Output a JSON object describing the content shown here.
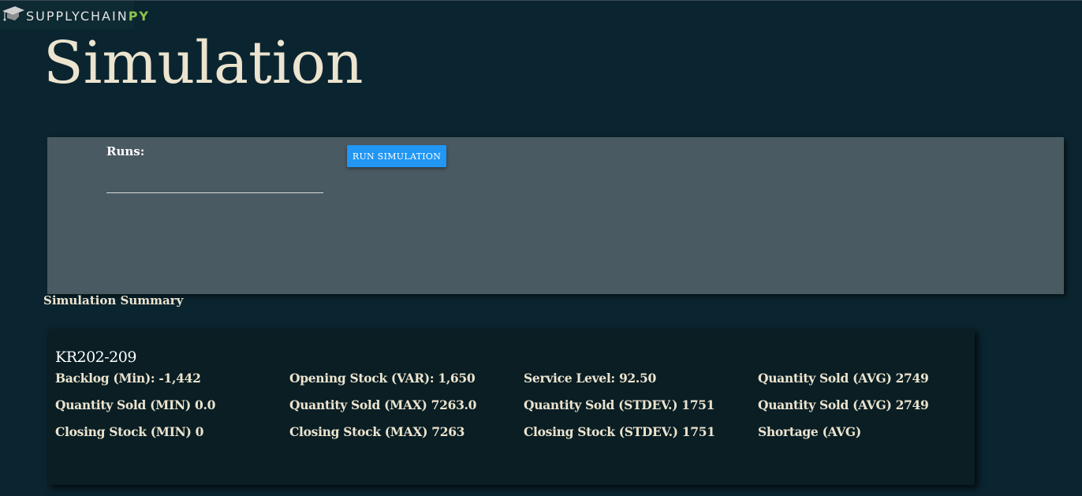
{
  "logo": {
    "text_main": "SUPPLYCHAIN",
    "text_accent": "PY",
    "icon": "graduation-cap-icon"
  },
  "page": {
    "title": "Simulation"
  },
  "controls": {
    "runs_label": "Runs:",
    "runs_value": "",
    "run_button_label": "RUN SIMULATION"
  },
  "summary": {
    "heading": "Simulation Summary",
    "card_title": "KR202-209",
    "stats": [
      "Backlog (Min): -1,442",
      "Opening Stock (VAR): 1,650",
      "Service Level: 92.50",
      "Quantity Sold (AVG) 2749",
      "Quantity Sold (MIN) 0.0",
      "Quantity Sold (MAX) 7263.0",
      "Quantity Sold (STDEV.) 1751",
      "Quantity Sold (AVG) 2749",
      "Closing Stock (MIN) 0",
      "Closing Stock (MAX) 7263",
      "Closing Stock (STDEV.) 1751",
      "Shortage (AVG)"
    ]
  },
  "colors": {
    "background": "#0b2530",
    "panel": "#4a5a62",
    "card": "#0a1e24",
    "button": "#2196f3",
    "text": "#ece4cf",
    "logo_accent": "#8bc34a"
  }
}
